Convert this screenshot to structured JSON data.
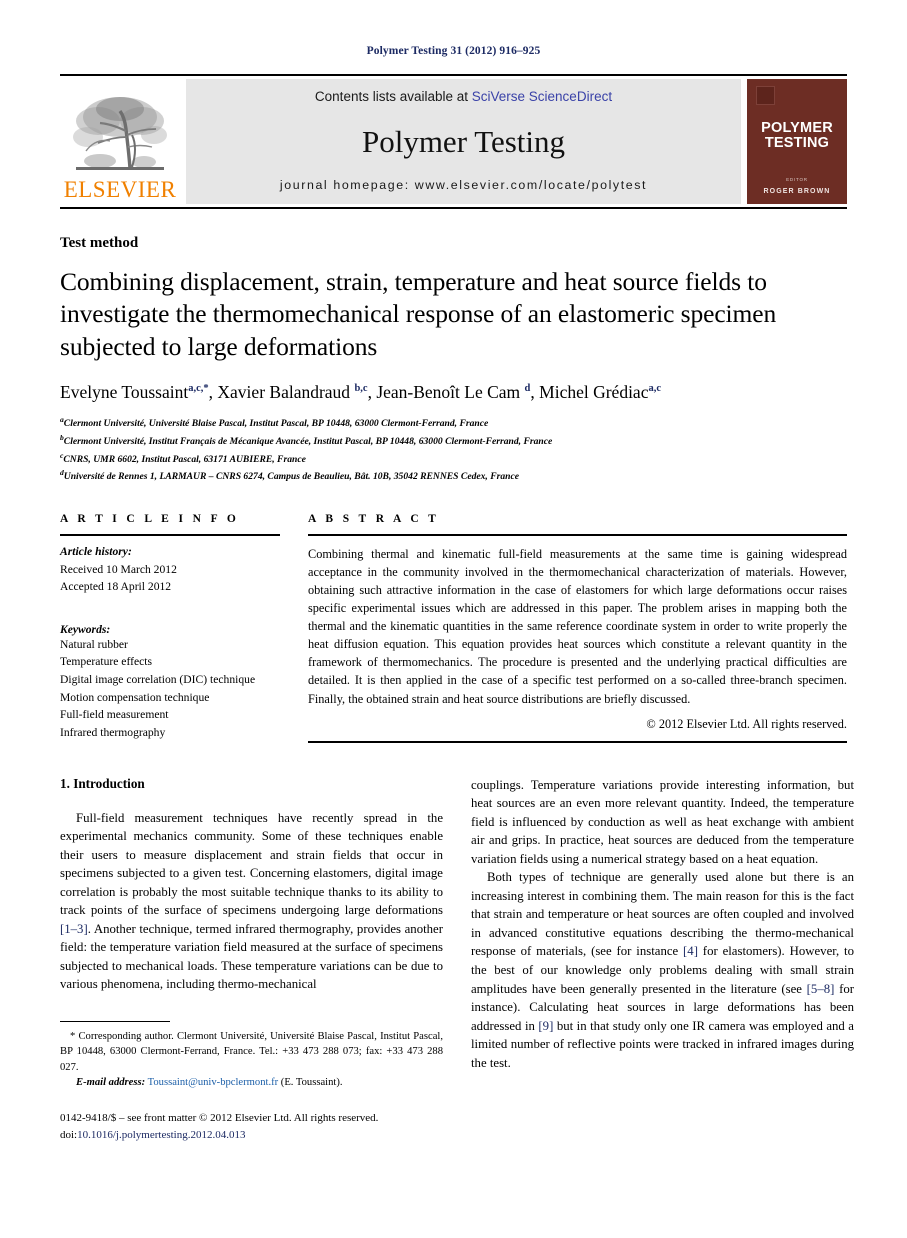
{
  "running_head": "Polymer Testing 31 (2012) 916–925",
  "masthead": {
    "publisher_word": "ELSEVIER",
    "contents_prefix": "Contents lists available at ",
    "contents_link": "SciVerse ScienceDirect",
    "journal_name": "Polymer Testing",
    "homepage": "journal homepage: www.elsevier.com/locate/polytest",
    "cover": {
      "title_line1": "POLYMER",
      "title_line2": "TESTING",
      "editor_label": "EDITOR",
      "editor_name": "ROGER BROWN"
    },
    "link_color": "#3a42a8",
    "cover_color": "#6d2d24",
    "elsevier_orange": "#f08000"
  },
  "article": {
    "type": "Test method",
    "title": "Combining displacement, strain, temperature and heat source fields to investigate the thermomechanical response of an elastomeric specimen subjected to large deformations",
    "authors_html": "Evelyne Toussaint<sup>a,c,</sup><sup>*</sup>, Xavier Balandraud <sup>b,c</sup>, Jean-Benoît Le Cam <sup>d</sup>, Michel Grédiac<sup>a,c</sup>",
    "affiliations": [
      {
        "marker": "a",
        "text": "Clermont Université, Université Blaise Pascal, Institut Pascal, BP 10448, 63000 Clermont-Ferrand, France"
      },
      {
        "marker": "b",
        "text": "Clermont Université, Institut Français de Mécanique Avancée, Institut Pascal, BP 10448, 63000 Clermont-Ferrand, France"
      },
      {
        "marker": "c",
        "text": "CNRS, UMR 6602, Institut Pascal, 63171 AUBIERE, France"
      },
      {
        "marker": "d",
        "text": "Université de Rennes 1, LARMAUR – CNRS 6274, Campus de Beaulieu, Bât. 10B, 35042 RENNES Cedex, France"
      }
    ]
  },
  "article_info": {
    "heading": "A R T I C L E   I N F O",
    "history_label": "Article history:",
    "history": [
      "Received 10 March 2012",
      "Accepted 18 April 2012"
    ],
    "keywords_label": "Keywords:",
    "keywords": [
      "Natural rubber",
      "Temperature effects",
      "Digital image correlation (DIC) technique",
      "Motion compensation technique",
      "Full-field measurement",
      "Infrared thermography"
    ]
  },
  "abstract": {
    "heading": "A B S T R A C T",
    "text": "Combining thermal and kinematic full-field measurements at the same time is gaining widespread acceptance in the community involved in the thermomechanical characterization of materials. However, obtaining such attractive information in the case of elastomers for which large deformations occur raises specific experimental issues which are addressed in this paper. The problem arises in mapping both the thermal and the kinematic quantities in the same reference coordinate system in order to write properly the heat diffusion equation. This equation provides heat sources which constitute a relevant quantity in the framework of thermomechanics. The procedure is presented and the underlying practical difficulties are detailed. It is then applied in the case of a specific test performed on a so-called three-branch specimen. Finally, the obtained strain and heat source distributions are briefly discussed.",
    "copyright": "© 2012 Elsevier Ltd. All rights reserved."
  },
  "body": {
    "section_heading": "1. Introduction",
    "left_paragraph_1": "Full-field measurement techniques have recently spread in the experimental mechanics community. Some of these techniques enable their users to measure displacement and strain fields that occur in specimens subjected to a given test. Concerning elastomers, digital image correlation is probably the most suitable technique thanks to its ability to track points of the surface of specimens undergoing large deformations ",
    "left_ref_1": "[1–3]",
    "left_paragraph_1b": ". Another technique, termed infrared thermography, provides another field: the temperature variation field measured at the surface of specimens subjected to mechanical loads. These temperature variations can be due to various phenomena, including thermo-mechanical",
    "right_paragraph_1": "couplings. Temperature variations provide interesting information, but heat sources are an even more relevant quantity. Indeed, the temperature field is influenced by conduction as well as heat exchange with ambient air and grips. In practice, heat sources are deduced from the temperature variation fields using a numerical strategy based on a heat equation.",
    "right_paragraph_2a": "Both types of technique are generally used alone but there is an increasing interest in combining them. The main reason for this is the fact that strain and temperature or heat sources are often coupled and involved in advanced constitutive equations describing the thermo-mechanical response of materials, (see for instance ",
    "right_ref_4": "[4]",
    "right_paragraph_2b": " for elastomers). However, to the best of our knowledge only problems dealing with small strain amplitudes have been generally presented in the literature (see ",
    "right_ref_58": "[5–8]",
    "right_paragraph_2c": " for instance). Calculating heat sources in large deformations has been addressed in ",
    "right_ref_9": "[9]",
    "right_paragraph_2d": " but in that study only one IR camera was employed and a limited number of reflective points were tracked in infrared images during the test."
  },
  "footnote": {
    "corresponding": "* Corresponding author. Clermont Université, Université Blaise Pascal, Institut Pascal, BP 10448, 63000 Clermont-Ferrand, France. Tel.: +33 473 288 073; fax: +33 473 288 027.",
    "email_label": "E-mail address:",
    "email": "Toussaint@univ-bpclermont.fr",
    "email_suffix": " (E. Toussaint)."
  },
  "imprint": {
    "line1": "0142-9418/$ – see front matter © 2012 Elsevier Ltd. All rights reserved.",
    "doi_label": "doi:",
    "doi": "10.1016/j.polymertesting.2012.04.013"
  }
}
